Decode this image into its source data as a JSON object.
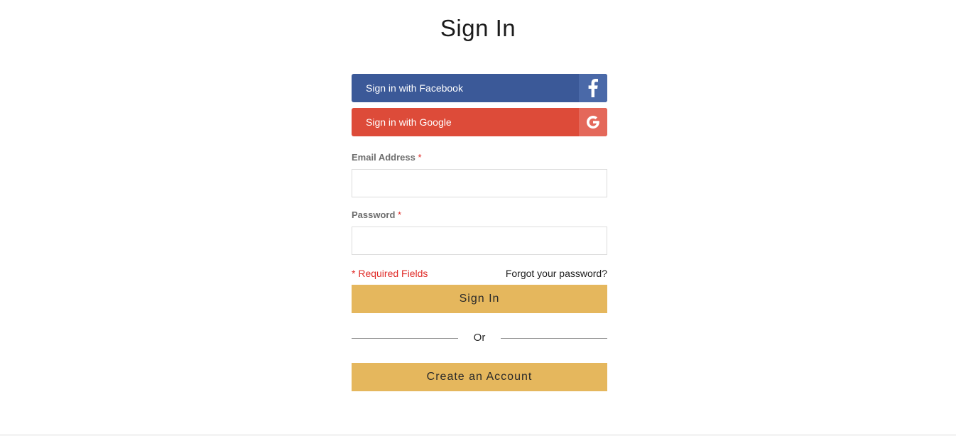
{
  "page": {
    "title": "Sign In"
  },
  "social": {
    "facebook_label": "Sign in with Facebook",
    "facebook_icon": "facebook-icon",
    "facebook_color": "#3b5998",
    "google_label": "Sign in with Google",
    "google_icon": "google-icon",
    "google_color": "#dd4b39"
  },
  "form": {
    "email_label": "Email Address",
    "email_value": "",
    "password_label": "Password",
    "password_value": "",
    "required_star": "*",
    "required_note": "* Required Fields",
    "forgot_link": "Forgot your password?",
    "signin_button": "Sign In",
    "divider_text": "Or",
    "create_account_button": "Create an Account"
  },
  "colors": {
    "accent": "#e5b75d",
    "required": "#e02b27"
  }
}
